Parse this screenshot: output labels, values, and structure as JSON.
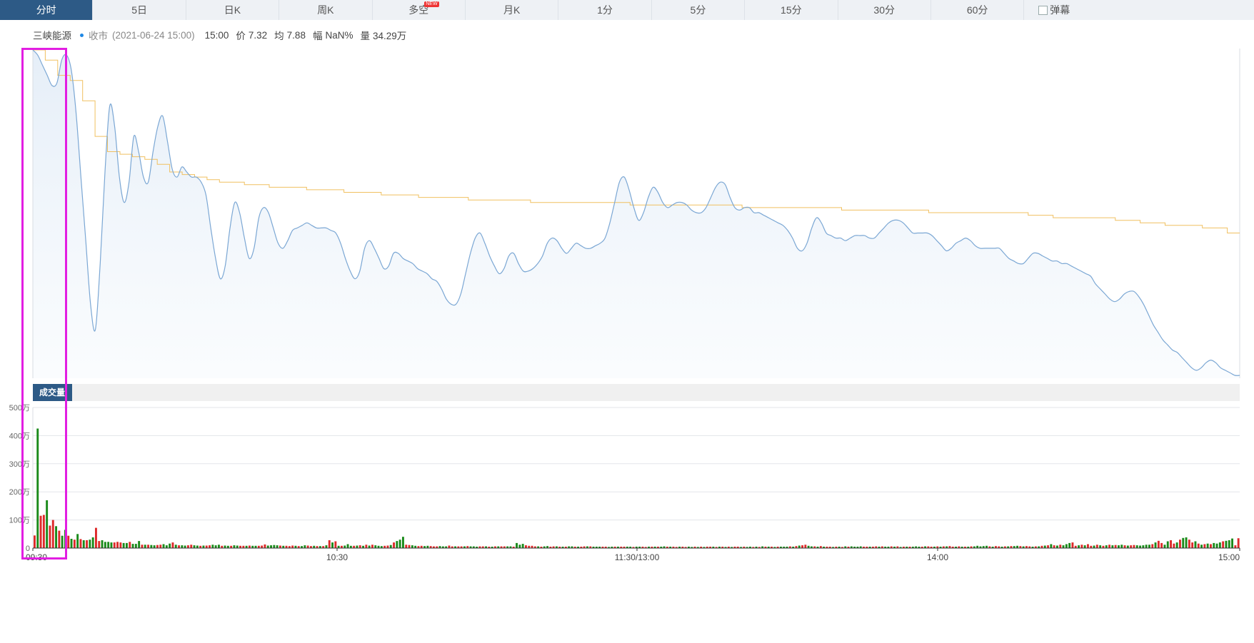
{
  "tabs": [
    {
      "label": "分时",
      "active": true
    },
    {
      "label": "5日"
    },
    {
      "label": "日K"
    },
    {
      "label": "周K"
    },
    {
      "label": "多空",
      "badge": "NEW"
    },
    {
      "label": "月K"
    },
    {
      "label": "1分"
    },
    {
      "label": "5分"
    },
    {
      "label": "15分"
    },
    {
      "label": "30分"
    },
    {
      "label": "60分"
    }
  ],
  "danmu_label": "弹幕",
  "info": {
    "name": "三峡能源",
    "status": "收市",
    "datetime": "(2021-06-24 15:00)",
    "time": "15:00",
    "price_label": "价",
    "price": "7.32",
    "avg_label": "均",
    "avg": "7.88",
    "range_label": "幅",
    "range": "NaN%",
    "volume_label": "量",
    "volume": "34.29万"
  },
  "colors": {
    "price_line": "#7ba7d4",
    "avg_line": "#f0c060",
    "up": "#dd2a2a",
    "down": "#1a8a1a",
    "tab_active": "#2d5a86",
    "highlight_box": "#e21ee2"
  },
  "chart_data": [
    {
      "type": "line",
      "title": "",
      "x_range": [
        "09:30",
        "15:00"
      ],
      "y_axis_labels": "none",
      "series": [
        {
          "name": "价",
          "values": [
            8.6,
            8.58,
            8.54,
            8.5,
            8.46,
            8.47,
            8.56,
            8.58,
            8.52,
            8.35,
            8.1,
            7.85,
            7.6,
            7.5,
            7.76,
            8.12,
            8.38,
            8.3,
            8.1,
            8.0,
            8.08,
            8.26,
            8.2,
            8.1,
            8.08,
            8.2,
            8.3,
            8.34,
            8.24,
            8.13,
            8.1,
            8.14,
            8.12,
            8.1,
            8.1,
            8.08,
            8.03,
            7.9,
            7.78,
            7.7,
            7.75,
            7.9,
            8.0,
            7.96,
            7.86,
            7.78,
            7.82,
            7.94,
            7.98,
            7.96,
            7.9,
            7.84,
            7.82,
            7.85,
            7.89,
            7.9,
            7.91,
            7.92,
            7.91,
            7.9,
            7.9,
            7.9,
            7.89,
            7.88,
            7.84,
            7.78,
            7.73,
            7.7,
            7.73,
            7.82,
            7.85,
            7.82,
            7.78,
            7.74,
            7.75,
            7.8,
            7.8,
            7.78,
            7.77,
            7.76,
            7.74,
            7.73,
            7.72,
            7.7,
            7.69,
            7.66,
            7.62,
            7.6,
            7.6,
            7.64,
            7.72,
            7.8,
            7.86,
            7.88,
            7.84,
            7.79,
            7.75,
            7.72,
            7.74,
            7.79,
            7.8,
            7.76,
            7.73,
            7.73,
            7.74,
            7.76,
            7.79,
            7.84,
            7.86,
            7.85,
            7.82,
            7.8,
            7.82,
            7.84,
            7.83,
            7.82,
            7.82,
            7.83,
            7.84,
            7.86,
            7.92,
            8.0,
            8.08,
            8.1,
            8.05,
            7.98,
            7.93,
            7.96,
            8.02,
            8.06,
            8.04,
            8.0,
            7.98,
            7.99,
            8.0,
            8.0,
            7.99,
            7.97,
            7.96,
            7.96,
            7.98,
            8.02,
            8.06,
            8.08,
            8.07,
            8.02,
            7.98,
            7.97,
            7.98,
            7.98,
            7.96,
            7.96,
            7.95,
            7.94,
            7.93,
            7.92,
            7.91,
            7.89,
            7.86,
            7.82,
            7.81,
            7.84,
            7.9,
            7.94,
            7.92,
            7.88,
            7.87,
            7.86,
            7.86,
            7.85,
            7.86,
            7.87,
            7.87,
            7.87,
            7.86,
            7.86,
            7.88,
            7.9,
            7.92,
            7.93,
            7.93,
            7.92,
            7.9,
            7.88,
            7.88,
            7.88,
            7.88,
            7.87,
            7.85,
            7.83,
            7.81,
            7.82,
            7.84,
            7.85,
            7.86,
            7.85,
            7.83,
            7.82,
            7.82,
            7.82,
            7.82,
            7.82,
            7.8,
            7.78,
            7.77,
            7.76,
            7.76,
            7.78,
            7.8,
            7.8,
            7.79,
            7.78,
            7.77,
            7.77,
            7.76,
            7.76,
            7.75,
            7.74,
            7.73,
            7.72,
            7.71,
            7.68,
            7.66,
            7.64,
            7.62,
            7.61,
            7.62,
            7.64,
            7.65,
            7.65,
            7.63,
            7.6,
            7.56,
            7.52,
            7.49,
            7.46,
            7.44,
            7.42,
            7.41,
            7.39,
            7.37,
            7.35,
            7.34,
            7.35,
            7.37,
            7.38,
            7.37,
            7.35,
            7.34,
            7.33,
            7.32,
            7.32
          ]
        },
        {
          "name": "均",
          "values": [
            8.6,
            8.56,
            8.5,
            8.48,
            8.4,
            8.26,
            8.2,
            8.19,
            8.18,
            8.17,
            8.15,
            8.12,
            8.11,
            8.1,
            8.09,
            8.08,
            8.08,
            8.07,
            8.07,
            8.06,
            8.06,
            8.06,
            8.05,
            8.05,
            8.05,
            8.04,
            8.04,
            8.04,
            8.03,
            8.03,
            8.03,
            8.02,
            8.02,
            8.02,
            8.02,
            8.01,
            8.01,
            8.01,
            8.01,
            8.01,
            8.0,
            8.0,
            8.0,
            8.0,
            8.0,
            8.0,
            8.0,
            8.0,
            7.99,
            7.99,
            7.99,
            7.99,
            7.99,
            7.99,
            7.99,
            7.99,
            7.99,
            7.98,
            7.98,
            7.98,
            7.98,
            7.98,
            7.98,
            7.98,
            7.98,
            7.97,
            7.97,
            7.97,
            7.97,
            7.97,
            7.97,
            7.97,
            7.96,
            7.96,
            7.96,
            7.96,
            7.96,
            7.96,
            7.96,
            7.96,
            7.95,
            7.95,
            7.94,
            7.94,
            7.94,
            7.94,
            7.94,
            7.93,
            7.93,
            7.92,
            7.92,
            7.91,
            7.91,
            7.91,
            7.9,
            7.9,
            7.88,
            7.88
          ]
        }
      ]
    },
    {
      "type": "bar",
      "title": "成交量",
      "x_tick_labels": [
        "09:30",
        "10:30",
        "11:30/13:00",
        "14:00",
        "15:00"
      ],
      "y_tick_labels": [
        "500万",
        "400万",
        "300万",
        "200万",
        "100万",
        "0"
      ],
      "ylim": [
        0,
        500
      ],
      "unit": "万",
      "grid": true,
      "values": [
        45,
        425,
        115,
        118,
        170,
        80,
        100,
        78,
        62,
        44,
        65,
        44,
        33,
        30,
        50,
        32,
        28,
        28,
        30,
        38,
        72,
        25,
        28,
        22,
        22,
        20,
        20,
        22,
        20,
        18,
        18,
        22,
        15,
        15,
        25,
        12,
        12,
        12,
        11,
        10,
        11,
        12,
        14,
        10,
        16,
        20,
        12,
        10,
        10,
        9,
        10,
        12,
        10,
        9,
        8,
        9,
        9,
        10,
        12,
        10,
        12,
        8,
        9,
        8,
        8,
        10,
        9,
        8,
        8,
        8,
        9,
        8,
        8,
        8,
        9,
        13,
        9,
        10,
        11,
        10,
        9,
        8,
        8,
        7,
        9,
        8,
        7,
        7,
        10,
        9,
        7,
        8,
        7,
        7,
        7,
        10,
        28,
        20,
        24,
        8,
        8,
        9,
        14,
        8,
        8,
        9,
        10,
        8,
        12,
        9,
        12,
        10,
        8,
        7,
        8,
        9,
        11,
        20,
        25,
        30,
        40,
        12,
        11,
        10,
        8,
        7,
        8,
        7,
        8,
        7,
        6,
        6,
        7,
        6,
        6,
        9,
        6,
        6,
        6,
        6,
        6,
        7,
        6,
        6,
        5,
        6,
        6,
        6,
        5,
        5,
        6,
        6,
        6,
        6,
        6,
        6,
        5,
        18,
        12,
        15,
        10,
        8,
        8,
        6,
        6,
        5,
        6,
        7,
        5,
        6,
        6,
        5,
        5,
        5,
        6,
        6,
        5,
        5,
        5,
        6,
        6,
        6,
        5,
        5,
        5,
        5,
        5,
        4,
        5,
        5,
        5,
        5,
        5,
        5,
        5,
        4,
        5,
        5,
        5,
        4,
        5,
        5,
        5,
        5,
        5,
        6,
        5,
        5,
        5,
        4,
        5,
        5,
        4,
        5,
        4,
        5,
        4,
        5,
        4,
        5,
        5,
        5,
        4,
        5,
        5,
        4,
        5,
        4,
        5,
        5,
        4,
        5,
        4,
        5,
        4,
        5,
        4,
        6,
        5,
        5,
        5,
        4,
        5,
        5,
        5,
        5,
        6,
        5,
        7,
        9,
        10,
        12,
        8,
        6,
        6,
        5,
        7,
        5,
        5,
        5,
        4,
        5,
        5,
        4,
        6,
        5,
        6,
        5,
        5,
        6,
        5,
        5,
        5,
        5,
        6,
        5,
        6,
        5,
        5,
        6,
        5,
        6,
        4,
        5,
        5,
        5,
        5,
        6,
        5,
        5,
        6,
        6,
        5,
        5,
        6,
        5,
        6,
        6,
        7,
        5,
        5,
        6,
        5,
        5,
        5,
        6,
        6,
        8,
        6,
        7,
        8,
        6,
        5,
        7,
        6,
        5,
        6,
        6,
        7,
        7,
        8,
        7,
        6,
        7,
        6,
        5,
        6,
        6,
        8,
        9,
        10,
        14,
        10,
        9,
        12,
        10,
        14,
        18,
        20,
        8,
        10,
        12,
        10,
        14,
        8,
        9,
        12,
        10,
        8,
        10,
        12,
        10,
        11,
        10,
        12,
        10,
        9,
        10,
        11,
        10,
        9,
        10,
        12,
        12,
        14,
        20,
        26,
        18,
        12,
        24,
        28,
        16,
        20,
        30,
        36,
        38,
        30,
        20,
        24,
        16,
        12,
        14,
        16,
        14,
        18,
        16,
        20,
        24,
        26,
        28,
        34,
        10,
        35
      ],
      "direction": [
        "u",
        "d",
        "u",
        "u",
        "d",
        "u",
        "u",
        "d",
        "u",
        "d",
        "d",
        "u",
        "d",
        "u",
        "d",
        "u",
        "d",
        "u",
        "d",
        "d",
        "u",
        "u",
        "d",
        "d",
        "d",
        "d",
        "u",
        "u",
        "u",
        "d",
        "d",
        "u",
        "d",
        "d",
        "d",
        "u",
        "d",
        "u",
        "d",
        "d",
        "u",
        "u",
        "d",
        "d",
        "d",
        "u",
        "d",
        "u",
        "d",
        "d",
        "u",
        "u",
        "d",
        "d",
        "u",
        "d",
        "u",
        "u",
        "d",
        "d",
        "d",
        "u",
        "d",
        "d",
        "u",
        "d",
        "d",
        "u",
        "u",
        "d",
        "u",
        "d",
        "d",
        "u",
        "u",
        "u",
        "d",
        "d",
        "d",
        "d",
        "u",
        "d",
        "u",
        "u",
        "u",
        "d",
        "u",
        "d",
        "d",
        "u",
        "u",
        "d",
        "u",
        "d",
        "u",
        "d",
        "u",
        "d",
        "u",
        "d",
        "u",
        "d",
        "d",
        "d",
        "u",
        "d",
        "u",
        "d",
        "u",
        "d",
        "u",
        "d",
        "d",
        "d",
        "u",
        "u",
        "d",
        "u",
        "d",
        "d",
        "d",
        "u",
        "u",
        "d",
        "d",
        "u",
        "u",
        "d",
        "d",
        "u",
        "u",
        "u",
        "d",
        "d",
        "d",
        "u",
        "u",
        "d",
        "u",
        "u",
        "d",
        "u",
        "d",
        "d",
        "d",
        "u",
        "u",
        "d",
        "u",
        "d",
        "u",
        "d",
        "u",
        "u",
        "d",
        "d",
        "u",
        "d",
        "d",
        "d",
        "u",
        "u",
        "u",
        "u",
        "d",
        "u",
        "d",
        "d",
        "u",
        "u",
        "d",
        "u",
        "d",
        "u",
        "d",
        "d",
        "u",
        "d",
        "u",
        "u",
        "d",
        "u",
        "d",
        "d",
        "d",
        "u",
        "u",
        "d",
        "d",
        "u",
        "d",
        "u",
        "u",
        "d",
        "d",
        "u",
        "d",
        "d",
        "u",
        "u",
        "d",
        "u",
        "d",
        "u",
        "d",
        "d",
        "u",
        "d",
        "u",
        "u",
        "d",
        "u",
        "u",
        "d",
        "d",
        "u",
        "d",
        "u",
        "d",
        "u",
        "u",
        "d",
        "u",
        "d",
        "u",
        "d",
        "u",
        "d",
        "u",
        "u",
        "d",
        "u",
        "d",
        "d",
        "u",
        "d",
        "u",
        "d",
        "u",
        "d",
        "u",
        "d",
        "u",
        "d",
        "d",
        "d",
        "u",
        "d",
        "u",
        "d",
        "u",
        "u",
        "d",
        "d",
        "u",
        "d",
        "u",
        "d",
        "u",
        "u",
        "d",
        "u",
        "d",
        "u",
        "d",
        "u",
        "d",
        "d",
        "d",
        "d",
        "u",
        "u",
        "d",
        "u",
        "u",
        "d",
        "u",
        "d",
        "d",
        "u",
        "d",
        "u",
        "d",
        "u",
        "d",
        "u",
        "d",
        "d",
        "d",
        "u",
        "d",
        "u",
        "u",
        "d",
        "u",
        "d",
        "u",
        "d",
        "u",
        "u",
        "d",
        "u",
        "d",
        "u",
        "d",
        "u",
        "d",
        "d",
        "d",
        "d",
        "d",
        "u",
        "d",
        "u",
        "u",
        "d",
        "u",
        "d",
        "u",
        "d",
        "d",
        "u",
        "d",
        "u",
        "u",
        "d",
        "u",
        "d",
        "u",
        "d",
        "u",
        "d",
        "u",
        "d",
        "u",
        "d",
        "d",
        "d",
        "u",
        "u",
        "d",
        "u",
        "d",
        "u",
        "u",
        "d",
        "u",
        "d",
        "u",
        "d",
        "u",
        "d",
        "u",
        "d",
        "d",
        "u",
        "d",
        "u",
        "u",
        "d",
        "d",
        "d",
        "d",
        "d",
        "u",
        "d",
        "u",
        "u",
        "d",
        "d",
        "u",
        "u",
        "d",
        "u",
        "d",
        "d",
        "u",
        "u",
        "d",
        "u",
        "d",
        "u",
        "d",
        "u",
        "d",
        "d",
        "d",
        "u",
        "d",
        "d",
        "d",
        "u",
        "u",
        "d",
        "u",
        "d",
        "d",
        "d",
        "u",
        "u",
        "u",
        "d",
        "u",
        "d",
        "u",
        "d",
        "u",
        "d",
        "u",
        "d",
        "u",
        "d",
        "u"
      ]
    }
  ]
}
